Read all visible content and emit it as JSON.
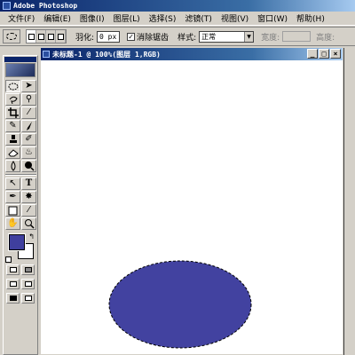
{
  "app": {
    "title": "Adobe Photoshop"
  },
  "menu": [
    "文件(F)",
    "编辑(E)",
    "图像(I)",
    "图层(L)",
    "选择(S)",
    "滤镜(T)",
    "视图(V)",
    "窗口(W)",
    "帮助(H)"
  ],
  "options": {
    "feather_label": "羽化:",
    "feather_value": "0 px",
    "antialias_checked": "✓",
    "antialias_label": "消除锯齿",
    "style_label": "样式:",
    "style_value": "正常",
    "width_label": "宽度:",
    "height_label": "高度:"
  },
  "document": {
    "title": "未标题-1 @ 100%(图层 1,RGB)",
    "min_btn": "_",
    "max_btn": "□",
    "close_btn": "×"
  },
  "toolbox": {
    "type_tool": "T"
  },
  "colors": {
    "foreground": "#3f3f9e",
    "background": "#ffffff",
    "ellipse_fill": "#4242a0"
  }
}
